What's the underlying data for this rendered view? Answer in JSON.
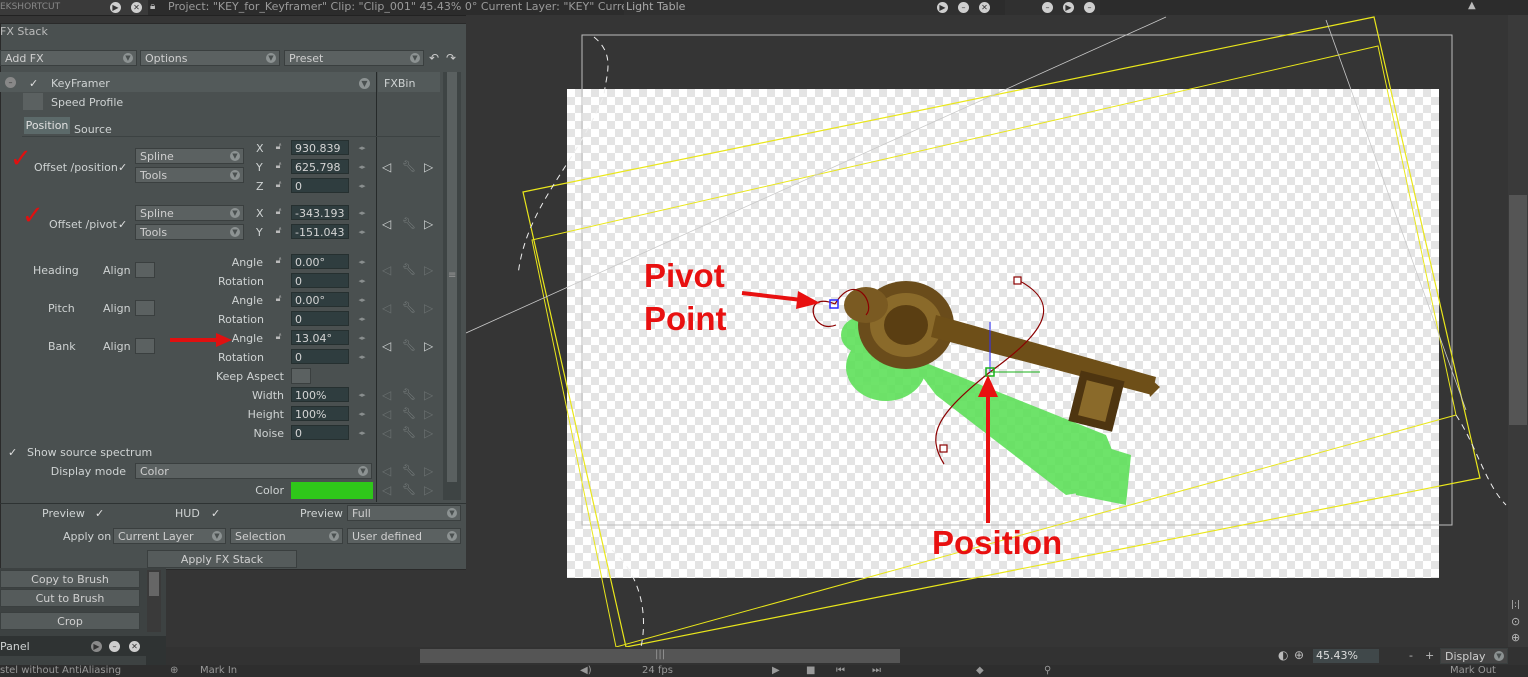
{
  "topbar": {
    "shortcut_label": "EKSHORTCUT",
    "project_info": "Project:  \"KEY_for_Keyframer\"  Clip: \"Clip_001\"   45.43%   0°   Current Layer: \"KEY\"  Current",
    "lighttable_title": "Light Table"
  },
  "fx": {
    "panel_title": "FX Stack",
    "add_fx": "Add FX",
    "options": "Options",
    "preset": "Preset",
    "effect_name": "KeyFramer",
    "speed_profile": "Speed Profile",
    "fxbin": "FXBin",
    "tab_position": "Position",
    "tab_source": "Source",
    "offset_position": "Offset /position",
    "offset_pivot": "Offset /pivot",
    "spline": "Spline",
    "tools": "Tools",
    "axis_x": "X",
    "axis_y": "Y",
    "axis_z": "Z",
    "pos_x": "930.839",
    "pos_y": "625.798",
    "pos_z": "0",
    "pivot_x": "-343.193",
    "pivot_y": "-151.043",
    "heading": "Heading",
    "pitch": "Pitch",
    "bank": "Bank",
    "align": "Align",
    "angle": "Angle",
    "rotation": "Rotation",
    "heading_angle": "0.00°",
    "heading_rotation": "0",
    "pitch_angle": "0.00°",
    "pitch_rotation": "0",
    "bank_angle": "13.04°",
    "bank_rotation": "0",
    "keep_aspect": "Keep Aspect",
    "width": "Width",
    "width_val": "100%",
    "height": "Height",
    "height_val": "100%",
    "noise": "Noise",
    "noise_val": "0",
    "show_spectrum": "Show source spectrum",
    "display_mode": "Display mode",
    "display_mode_val": "Color",
    "color": "Color",
    "color_hex": "#2fc71a",
    "preview": "Preview",
    "hud": "HUD",
    "preview2": "Preview",
    "preview_val": "Full",
    "apply_on": "Apply on",
    "apply_current_layer": "Current Layer",
    "apply_selection": "Selection",
    "apply_user": "User defined",
    "apply_fx_stack": "Apply FX Stack"
  },
  "lower": {
    "copy_to_brush": "Copy to Brush",
    "cut_to_brush": "Cut to Brush",
    "crop": "Crop",
    "panel_label": "Panel",
    "pastel_label": "stel without AntiAliasing"
  },
  "canvas": {
    "pivot_label_1": "Pivot",
    "pivot_label_2": "Point",
    "position_label": "Position",
    "annotation_color": "#e81010"
  },
  "bottom": {
    "zoom": "45.43%",
    "minus": "-",
    "plus": "+",
    "display": "Display",
    "mark_in": "Mark In",
    "fps": "24 fps",
    "mark_out": "Mark Out"
  }
}
